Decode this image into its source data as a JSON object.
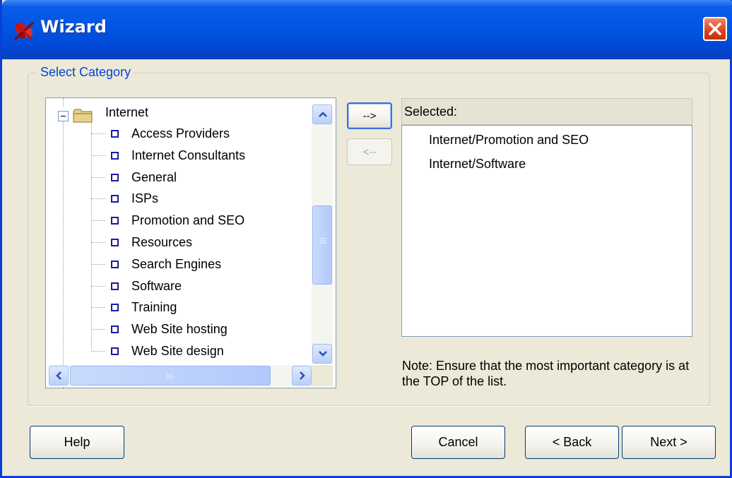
{
  "window": {
    "title": "Wizard"
  },
  "group": {
    "legend": "Select Category"
  },
  "tree": {
    "root_label": "Internet",
    "items": [
      "Access Providers",
      "Internet Consultants",
      "General",
      "ISPs",
      "Promotion and SEO",
      "Resources",
      "Search Engines",
      "Software",
      "Training",
      "Web Site hosting",
      "Web Site design"
    ]
  },
  "buttons": {
    "add": "-->",
    "remove": "<--",
    "help": "Help",
    "cancel": "Cancel",
    "back": "< Back",
    "next": "Next >"
  },
  "selected": {
    "header": "Selected:",
    "items": [
      "Internet/Promotion and SEO",
      "Internet/Software"
    ]
  },
  "note": "Note: Ensure that the most important category is at the TOP of the list.",
  "colors": {
    "title_bar": "#0055e5",
    "legend_text": "#0046d5",
    "checkbox": "#1a1aa8"
  },
  "icons": [
    "app-logo-icon",
    "close-icon",
    "folder-icon",
    "scroll-up-icon",
    "scroll-down-icon",
    "scroll-left-icon",
    "scroll-right-icon"
  ]
}
